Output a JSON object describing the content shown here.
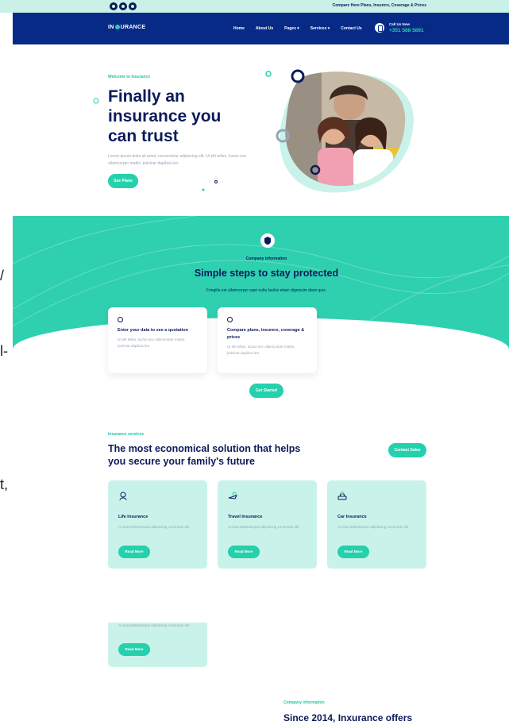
{
  "topbar": {
    "note": "Compare Here Plans, Insurers, Coverage & Prices"
  },
  "header": {
    "logo_left": "IN",
    "logo_right": "URANCE",
    "nav": [
      "Home",
      "About Us",
      "Pages ▾",
      "Services ▾",
      "Contact Us"
    ],
    "call_label": "Call Us Now",
    "call_number": "+351 588 5891"
  },
  "hero": {
    "kicker": "Welcome to Insurance",
    "title": "Finally an insurance you can trust",
    "text": "Lorem ipsum dolor sit amet, consectetur adipiscing elit. Ut elit tellus, luctus nec ullamcorper mattis, pulvinar dapibus leo.",
    "button": "See Plans"
  },
  "steps": {
    "kicker": "Company information",
    "title": "Simple steps to stay protected",
    "subtitle": "Fringilla est ullamcorper eget nulla facilisi etiam dignissim diam quis.",
    "cards": [
      {
        "title": "Enter your data to see a quotation",
        "text": "Ut elit tellus, luctus nec ullamcorper mattis, pulvinar dapibus leo."
      },
      {
        "title": "Compare plans, insurers, coverage & prices",
        "text": "Ut elit tellus, luctus nec ullamcorper mattis, pulvinar dapibus leo."
      }
    ],
    "button": "Get Started"
  },
  "services": {
    "kicker": "Insurance services",
    "title": "The most economical solution that helps you secure your family's future",
    "contact_button": "Contact Sales",
    "cards": [
      {
        "title": "Life Insurance",
        "text": "At erat pellentesque adipiscing commodo elit",
        "button": "Read More",
        "icon": "life-insurance-icon"
      },
      {
        "title": "Travel Insurance",
        "text": "At erat pellentesque adipiscing commodo elit",
        "button": "Read More",
        "icon": "travel-insurance-icon"
      },
      {
        "title": "Car Insurance",
        "text": "At erat pellentesque adipiscing commodo elit",
        "button": "Read More",
        "icon": "car-insurance-icon"
      }
    ],
    "partial_card": {
      "text": "At erat pellentesque adipiscing commodo elit",
      "button": "Read More"
    }
  },
  "about": {
    "kicker": "Company information",
    "title": "Since 2014, Inxurance offers"
  },
  "edge_fragments": [
    "/",
    "l-",
    "t,"
  ],
  "colors": {
    "navy": "#082a87",
    "teal": "#25d0ac",
    "mint": "#c9f3ea",
    "text": "#0b1b5a"
  }
}
